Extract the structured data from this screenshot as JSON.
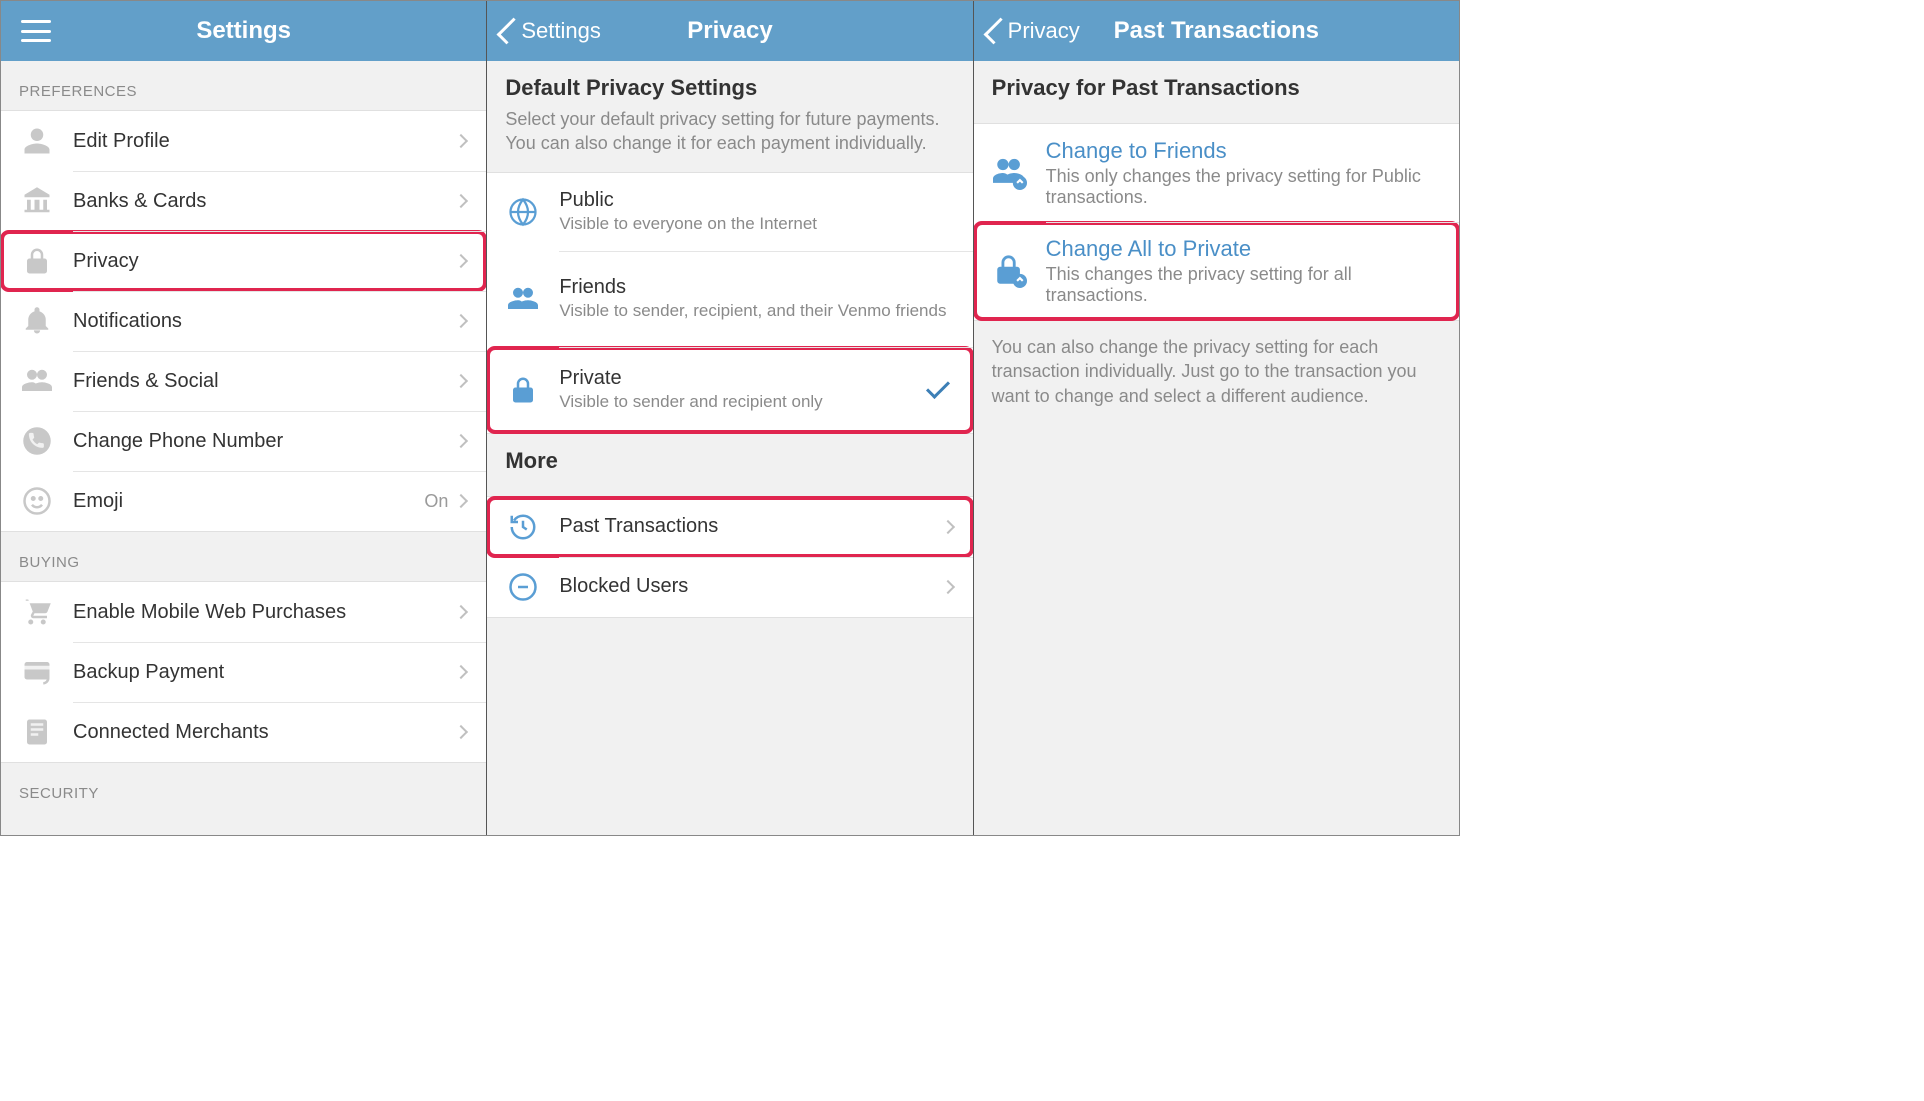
{
  "pane1": {
    "title": "Settings",
    "sections": {
      "preferences": "PREFERENCES",
      "buying": "BUYING",
      "security": "SECURITY"
    },
    "rows": {
      "editProfile": "Edit Profile",
      "banksCards": "Banks & Cards",
      "privacy": "Privacy",
      "notifications": "Notifications",
      "friendsSocial": "Friends & Social",
      "changePhone": "Change Phone Number",
      "emoji": "Emoji",
      "emojiValue": "On",
      "enableMobileWeb": "Enable Mobile Web Purchases",
      "backupPayment": "Backup Payment",
      "connectedMerchants": "Connected Merchants"
    }
  },
  "pane2": {
    "backLabel": "Settings",
    "title": "Privacy",
    "defaultHeader": "Default Privacy Settings",
    "defaultSub": "Select your default privacy setting for future payments. You can also change it for each payment individually.",
    "options": {
      "public": {
        "label": "Public",
        "sub": "Visible to everyone on the Internet"
      },
      "friends": {
        "label": "Friends",
        "sub": "Visible to sender, recipient, and their Venmo friends"
      },
      "private": {
        "label": "Private",
        "sub": "Visible to sender and recipient only"
      }
    },
    "moreHeader": "More",
    "more": {
      "pastTransactions": "Past Transactions",
      "blockedUsers": "Blocked Users"
    }
  },
  "pane3": {
    "backLabel": "Privacy",
    "title": "Past Transactions",
    "header": "Privacy for Past Transactions",
    "actions": {
      "toFriends": {
        "label": "Change to Friends",
        "sub": "This only changes the privacy setting for Public transactions."
      },
      "toPrivate": {
        "label": "Change All to Private",
        "sub": "This changes the privacy setting for all transactions."
      }
    },
    "footer": "You can also change the privacy setting for each transaction individually. Just go to the transaction you want to change and select a different audience."
  }
}
